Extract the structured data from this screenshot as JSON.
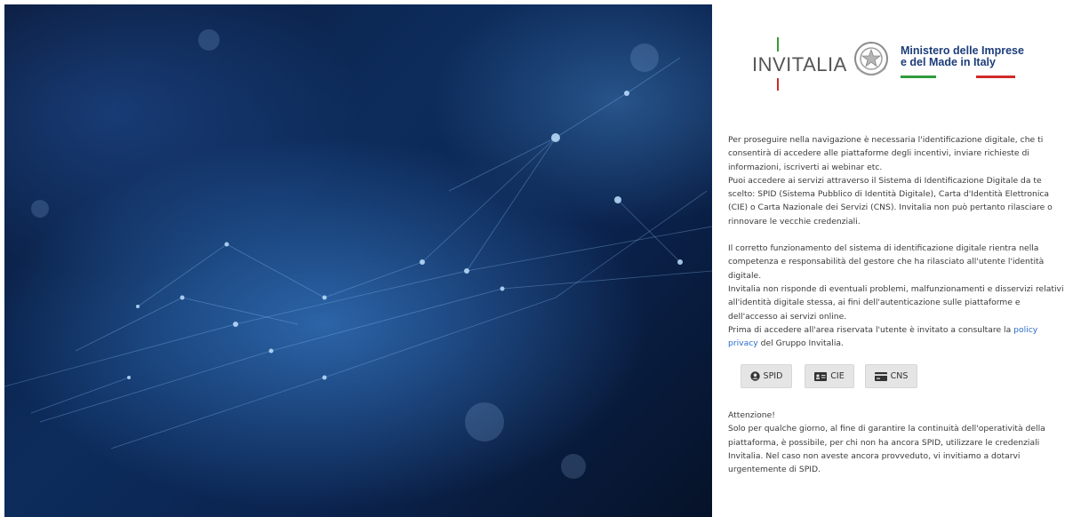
{
  "header": {
    "brand": "INVITALIA",
    "ministry_line1": "Ministero delle Imprese",
    "ministry_line2": "e del Made in Italy"
  },
  "intro": {
    "p1_a": "Per proseguire nella navigazione è necessaria l'identificazione digitale, che ti",
    "p1_b": "consentirà di accedere alle piattaforme degli incentivi, inviare richieste di",
    "p1_c": "informazioni, iscriverti ai webinar etc.",
    "p1_d": "Puoi accedere ai servizi attraverso il Sistema di Identificazione Digitale da te",
    "p1_e": "scelto: SPID (Sistema Pubblico di Identità Digitale), Carta d'Identità Elettronica",
    "p1_f": "(CIE) o Carta Nazionale dei Servizi (CNS). Invitalia non può pertanto rilasciare o",
    "p1_g": "rinnovare le vecchie credenziali.",
    "p2_a": "Il corretto funzionamento del sistema di identificazione digitale rientra nella",
    "p2_b": "competenza e responsabilità del gestore che ha rilasciato all'utente l'identità",
    "p2_c": "digitale.",
    "p2_d": "Invitalia non risponde di eventuali problemi, malfunzionamenti e disservizi relativi",
    "p2_e": "all'identità digitale stessa, ai fini dell'autenticazione sulle piattaforme e",
    "p2_f": "dell'accesso ai servizi online.",
    "p2_g": "Prima di accedere all'area riservata l'utente è invitato a consultare la",
    "policy_link_1": "policy",
    "policy_link_2": "privacy",
    "p2_h": "del Gruppo Invitalia."
  },
  "buttons": {
    "spid": "SPID",
    "cie": "CIE",
    "cns": "CNS"
  },
  "notice": {
    "title": "Attenzione!",
    "l1": "Solo per qualche giorno, al fine di garantire la continuità dell'operatività della",
    "l2": "piattaforma, è possibile, per chi non ha ancora SPID, utilizzare le credenziali",
    "l3": "Invitalia. Nel caso non aveste ancora provveduto, vi invitiamo a dotarvi",
    "l4": "urgentemente di SPID."
  },
  "colors": {
    "link": "#2b6cc7",
    "ministry_text": "#1d3d7a",
    "flag_green": "#2e9b3c",
    "flag_red": "#d02a2a"
  }
}
